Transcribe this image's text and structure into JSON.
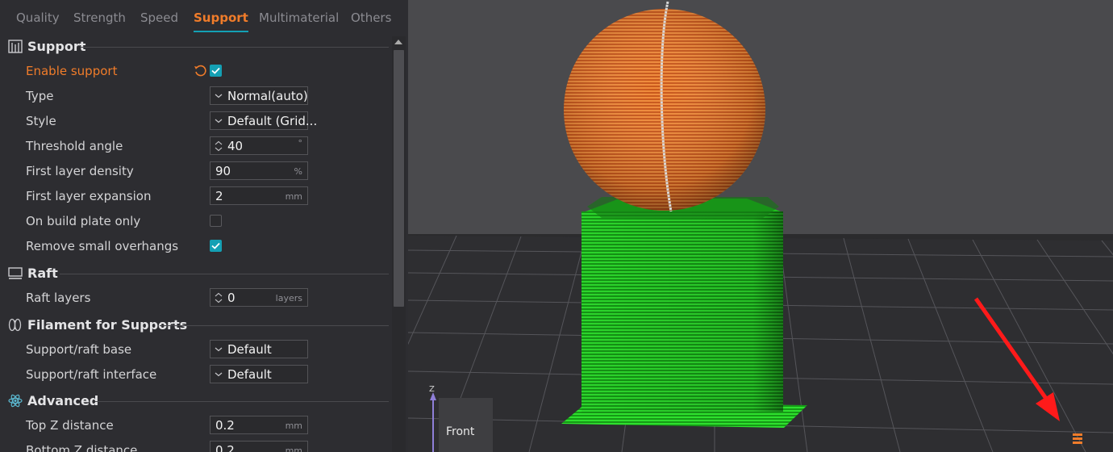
{
  "tabs": [
    {
      "label": "Quality",
      "active": false
    },
    {
      "label": "Strength",
      "active": false
    },
    {
      "label": "Speed",
      "active": false
    },
    {
      "label": "Support",
      "active": true
    },
    {
      "label": "Multimaterial",
      "active": false
    },
    {
      "label": "Others",
      "active": false
    }
  ],
  "colors": {
    "accent_orange": "#f07c2a",
    "accent_teal": "#14a0b4",
    "panel_bg": "#2d2d31",
    "support_green": "#22cc22",
    "model_orange": "#e0742a"
  },
  "sections": {
    "support": {
      "title": "Support",
      "icon": "support-icon",
      "rows": {
        "enable_support": {
          "label": "Enable support",
          "checked": true,
          "modified": true
        },
        "type": {
          "label": "Type",
          "value": "Normal(auto)"
        },
        "style": {
          "label": "Style",
          "value": "Default (Grid..."
        },
        "threshold_angle": {
          "label": "Threshold angle",
          "value": "40",
          "unit": "°"
        },
        "first_layer_density": {
          "label": "First layer density",
          "value": "90",
          "unit": "%"
        },
        "first_layer_expansion": {
          "label": "First layer expansion",
          "value": "2",
          "unit": "mm"
        },
        "on_build_plate_only": {
          "label": "On build plate only",
          "checked": false
        },
        "remove_small_overhangs": {
          "label": "Remove small overhangs",
          "checked": true
        }
      }
    },
    "raft": {
      "title": "Raft",
      "icon": "raft-icon",
      "rows": {
        "raft_layers": {
          "label": "Raft layers",
          "value": "0",
          "unit": "layers"
        }
      }
    },
    "filament": {
      "title": "Filament for Supports",
      "icon": "filament-icon",
      "rows": {
        "base": {
          "label": "Support/raft base",
          "value": "Default"
        },
        "interface": {
          "label": "Support/raft interface",
          "value": "Default"
        }
      }
    },
    "advanced": {
      "title": "Advanced",
      "icon": "advanced-icon",
      "rows": {
        "top_z": {
          "label": "Top Z distance",
          "value": "0.2",
          "unit": "mm"
        },
        "bottom_z": {
          "label": "Bottom Z distance",
          "value": "0.2",
          "unit": "mm"
        }
      }
    }
  },
  "viewport": {
    "view_cube_label": "Front",
    "axis_label": "Z"
  }
}
